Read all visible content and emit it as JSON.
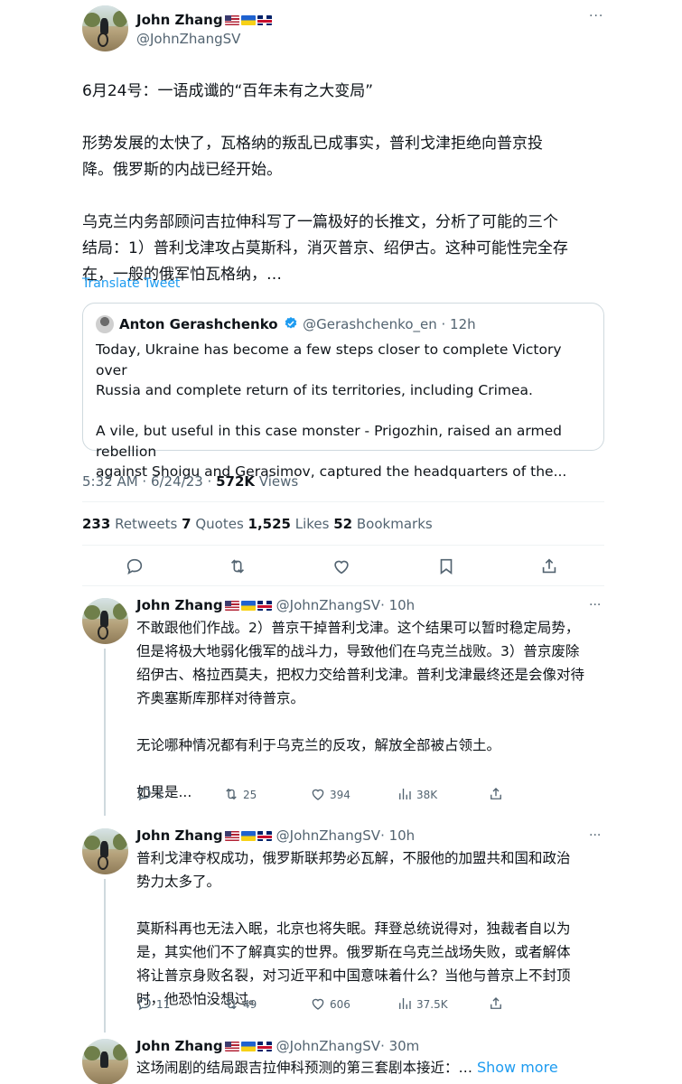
{
  "main_tweet": {
    "author_name": "John Zhang",
    "author_handle": "@JohnZhangSV",
    "flags": [
      "us-flag",
      "ukraine-flag",
      "uk-flag"
    ],
    "more_label": "···",
    "text": "6月24号：一语成谶的“百年未有之大变局”\n\n形势发展的太快了，瓦格纳的叛乱已成事实，普利戈津拒绝向普京投\n降。俄罗斯的内战已经开始。\n\n乌克兰内务部顾问吉拉伸科写了一篇极好的长推文，分析了可能的三个\n结局：1）普利戈津攻占莫斯科，消灭普京、绍伊古。这种可能性完全存\n在，一般的俄军怕瓦格纳，…",
    "translate_label": "Translate Tweet",
    "quote": {
      "author_name": "Anton Gerashchenko",
      "author_handle": "@Gerashchenko_en",
      "time": "· 12h",
      "text": "Today, Ukraine has become a few steps closer to complete Victory over\nRussia and complete return of its territories, including Crimea.\n\nA vile, but useful in this case monster - Prigozhin, raised an armed rebellion\nagainst Shoigu and Gerasimov, captured the headquarters of the..."
    },
    "timestamp": "5:32 AM · 6/24/23 · ",
    "views_count": "572K",
    "views_label": " Views",
    "stats": {
      "retweets_num": "233",
      "retweets_label": " Retweets ",
      "quotes_num": "7",
      "quotes_label": " Quotes ",
      "likes_num": "1,525",
      "likes_label": " Likes ",
      "bookmarks_num": "52",
      "bookmarks_label": " Bookmarks"
    }
  },
  "replies": [
    {
      "author_name": "John Zhang",
      "author_handle": "@JohnZhangSV",
      "time": "· 10h",
      "text": "不敢跟他们作战。2）普京干掉普利戈津。这个结果可以暂时稳定局势，\n但是将极大地弱化俄军的战斗力，导致他们在乌克兰战败。3）普京废除\n绍伊古、格拉西莫夫，把权力交给普利戈津。普利戈津最终还是会像对待\n齐奥塞斯库那样对待普京。\n\n无论哪种情况都有利于乌克兰的反攻，解放全部被占领土。\n\n如果是...",
      "replies_count": "1",
      "retweets_count": "25",
      "likes_count": "394",
      "views_count": "38K"
    },
    {
      "author_name": "John Zhang",
      "author_handle": "@JohnZhangSV",
      "time": "· 10h",
      "text": "普利戈津夺权成功，俄罗斯联邦势必瓦解，不服他的加盟共和国和政治\n势力太多了。\n\n莫斯科再也无法入眠，北京也将失眠。拜登总统说得对，独裁者自以为\n是，其实他们不了解真实的世界。俄罗斯在乌克兰战场失败，或者解体\n将让普京身败名裂，对习近平和中国意味着什么？当他与普京上不封顶\n时，他恐怕没想过。",
      "replies_count": "11",
      "retweets_count": "49",
      "likes_count": "606",
      "views_count": "37.5K"
    },
    {
      "author_name": "John Zhang",
      "author_handle": "@JohnZhangSV",
      "time": "· 30m",
      "text": "这场闹剧的结局跟吉拉伸科预测的第三套剧本接近：…",
      "show_more": "Show more"
    }
  ],
  "colors": {
    "accent": "#1d9bf0",
    "verified": "#1d9bf0",
    "secondary_text": "#536471",
    "border": "#cfd9de"
  }
}
